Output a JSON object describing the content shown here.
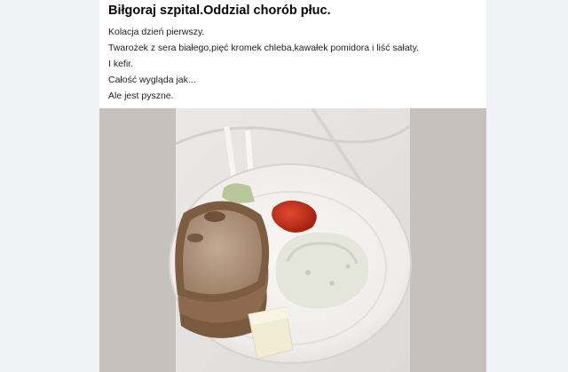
{
  "post": {
    "title": "Biłgoraj szpital.Oddzial chorób płuc.",
    "lines": [
      "Kolacja dzień pierwszy.",
      "Twarożek z sera białego,pięć kromek chleba,kawałek pomidora i liść sałaty.",
      "I kefir.",
      "Całość wygląda jak...",
      "Ale jest pyszne."
    ]
  },
  "photo": {
    "subject": "meal-on-paper-plate",
    "colors": {
      "backdrop": "#c6c1bc",
      "cloth": "#e7e5e4",
      "plate": "#f4f3f1",
      "bread_crust": "#8a6a4d",
      "bread_crumb": "#b49a80",
      "tomato": "#c8321f",
      "cottage_cheese": "#e6e8e0",
      "butter": "#f1ead2"
    }
  }
}
